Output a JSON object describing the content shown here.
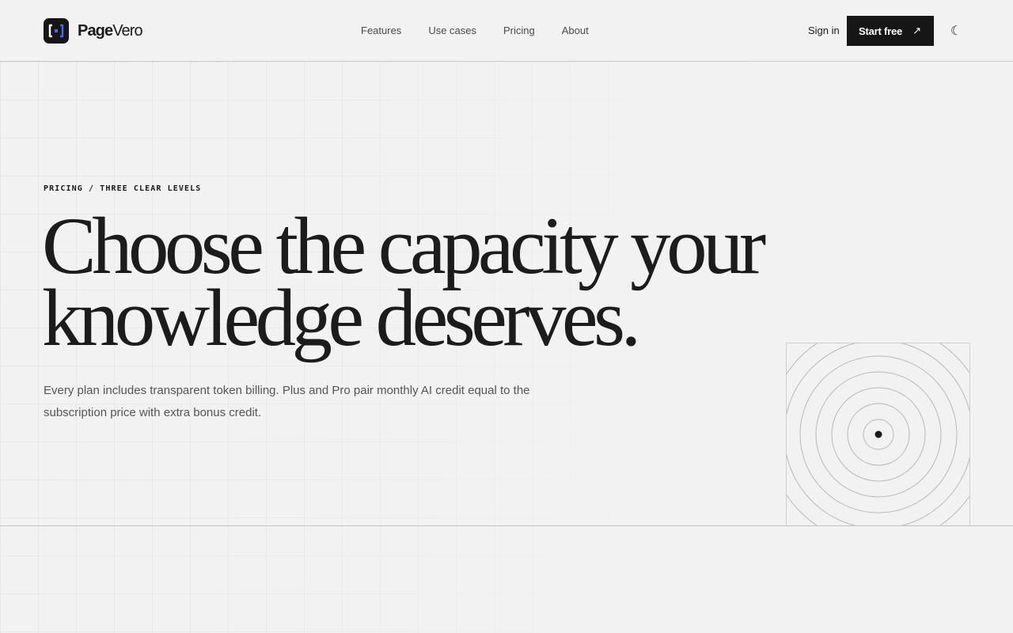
{
  "brand": {
    "name_bold": "Page",
    "name_rest": "Vero",
    "logo_icon": "bracket-dot-icon",
    "accent": "#3b6cf5"
  },
  "nav": {
    "items": [
      {
        "label": "Features"
      },
      {
        "label": "Use cases"
      },
      {
        "label": "Pricing"
      },
      {
        "label": "About"
      }
    ]
  },
  "header": {
    "sign_in_label": "Sign in",
    "start_label": "Start free",
    "start_icon": "↗",
    "theme_icon": "☾"
  },
  "hero": {
    "eyebrow": "PRICING / THREE CLEAR LEVELS",
    "headline_line1": "Choose the capacity your",
    "headline_line2": "knowledge deserves.",
    "subtext": "Every plan includes transparent token billing. Plus and Pro pair monthly AI credit equal to the subscription price with extra bonus credit."
  },
  "colors": {
    "text": "#1a1a1a",
    "muted": "#555555",
    "background": "#f2f2f2",
    "button": "#161616"
  }
}
